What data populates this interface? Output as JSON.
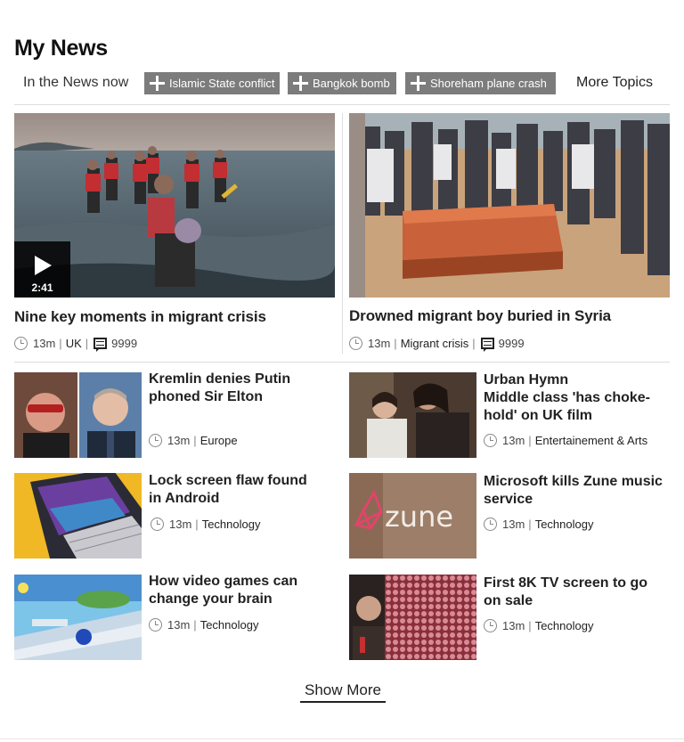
{
  "page": {
    "title": "My News"
  },
  "topics": {
    "in_the_news": "In the News now",
    "chips": [
      "Islamic State conflict",
      "Bangkok bomb",
      "Shoreham plane crash"
    ],
    "more": "More Topics"
  },
  "featured": [
    {
      "headline": "Nine key moments in migrant crisis",
      "time": "13m",
      "category": "UK",
      "comments": "9999",
      "video_duration": "2:41"
    },
    {
      "headline": "Drowned migrant boy buried in Syria",
      "time": "13m",
      "category": "Migrant crisis",
      "comments": "9999"
    }
  ],
  "stories": [
    {
      "headline": "Kremlin denies Putin phoned Sir Elton",
      "time": "13m",
      "category": "Europe"
    },
    {
      "headline_line1": "Urban Hymn",
      "headline": "Middle class 'has choke-hold' on UK film",
      "time": "13m",
      "category": "Entertainement & Arts"
    },
    {
      "headline": "Lock screen flaw found in Android",
      "time": "13m",
      "category": "Technology"
    },
    {
      "headline": "Microsoft kills Zune music service",
      "time": "13m",
      "category": "Technology",
      "image_text": "zune"
    },
    {
      "headline": "How video games can change your brain",
      "time": "13m",
      "category": "Technology"
    },
    {
      "headline": "First 8K TV screen to go on sale",
      "time": "13m",
      "category": "Technology"
    }
  ],
  "footer": {
    "show_more": "Show More"
  }
}
